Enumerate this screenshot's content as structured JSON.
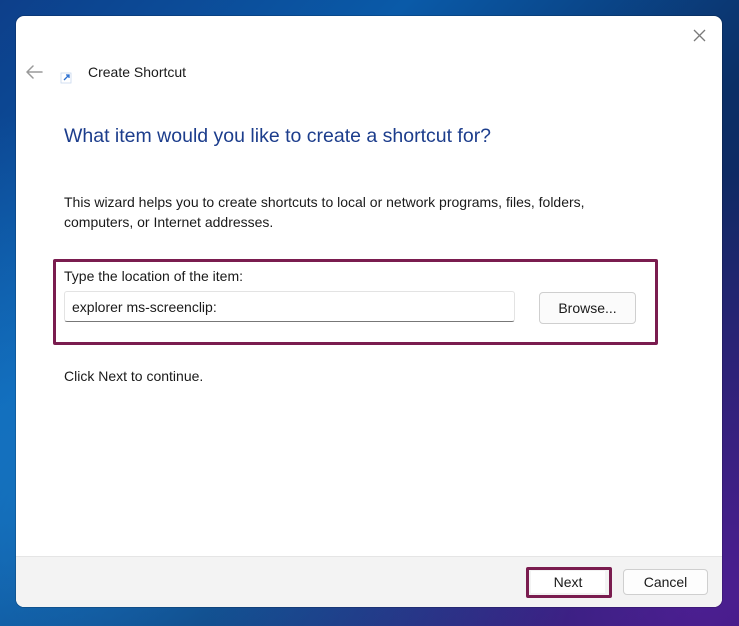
{
  "window": {
    "title": "Create Shortcut",
    "icon": "shortcut-arrow-icon",
    "back_icon": "back-arrow-icon",
    "close_icon": "close-icon"
  },
  "main": {
    "heading": "What item would you like to create a shortcut for?",
    "description": "This wizard helps you to create shortcuts to local or network programs, files, folders, computers, or Internet addresses.",
    "location_label": "Type the location of the item:",
    "location_value": "explorer ms-screenclip:",
    "browse_label": "Browse...",
    "continue_text": "Click Next to continue."
  },
  "footer": {
    "next_label": "Next",
    "cancel_label": "Cancel"
  },
  "colors": {
    "heading": "#1c3d8c",
    "highlight": "#7a1c4f",
    "footer_bg": "#f3f3f3"
  }
}
